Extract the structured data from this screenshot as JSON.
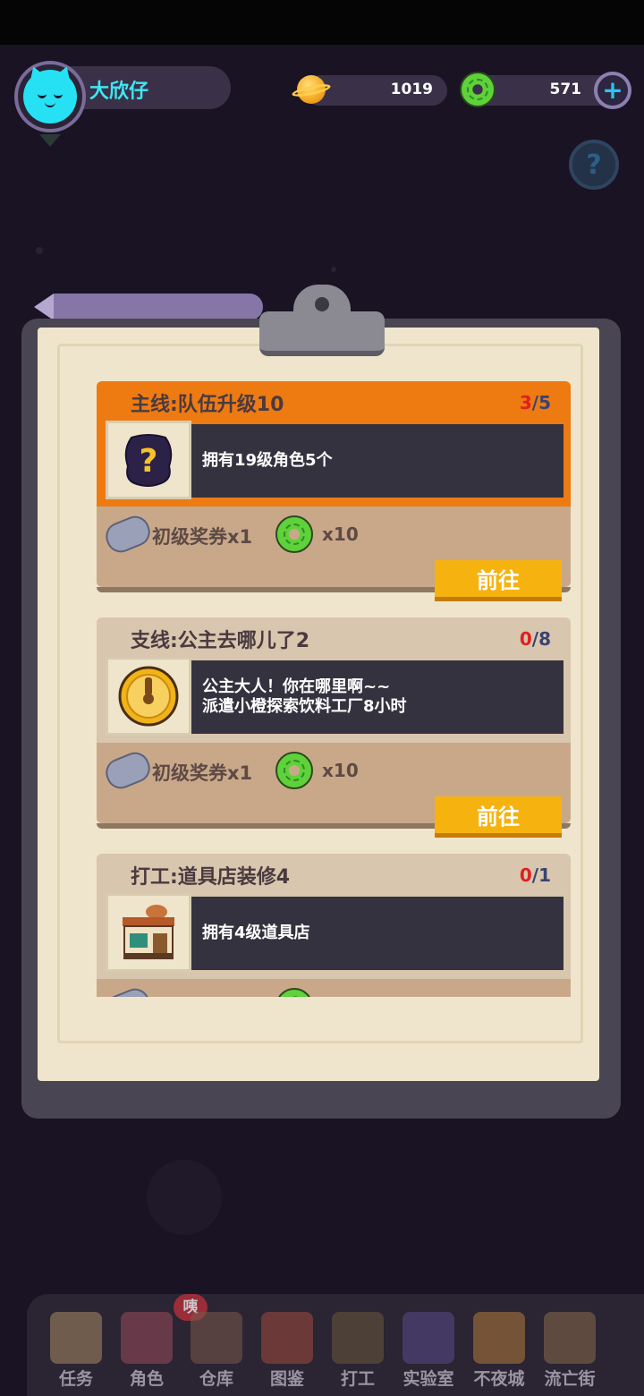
{
  "player": {
    "name": "大欣仔"
  },
  "resources": {
    "coins": "1019",
    "donuts": "571"
  },
  "tasks": [
    {
      "title": "主线:队伍升级10",
      "progress_current": "3",
      "progress_sep": "/",
      "progress_total": "5",
      "desc_line1": "拥有19级角色5个",
      "desc_line2": "",
      "reward_label": "初级奖券x1",
      "reward_qty": "x10",
      "button": "前往",
      "icon": "mystery-question-icon"
    },
    {
      "title": "支线:公主去哪儿了2",
      "progress_current": "0",
      "progress_sep": "/",
      "progress_total": "8",
      "desc_line1": "公主大人！你在哪里啊~~",
      "desc_line2": "派遣小橙探索饮料工厂8小时",
      "reward_label": "初级奖券x1",
      "reward_qty": "x10",
      "button": "前往",
      "icon": "gold-clock-icon"
    },
    {
      "title": "打工:道具店装修4",
      "progress_current": "0",
      "progress_sep": "/",
      "progress_total": "1",
      "desc_line1": "拥有4级道具店",
      "desc_line2": "",
      "icon": "item-shop-icon"
    }
  ],
  "nav": {
    "badge": "咦",
    "items": [
      "任务",
      "角色",
      "仓库",
      "图鉴",
      "打工",
      "实验室",
      "不夜城",
      "流亡街"
    ]
  },
  "colors": {
    "main_task": "#ee7a12",
    "side_task": "#d8c6ae",
    "button": "#f6b20f",
    "name": "#3fe7f4"
  }
}
